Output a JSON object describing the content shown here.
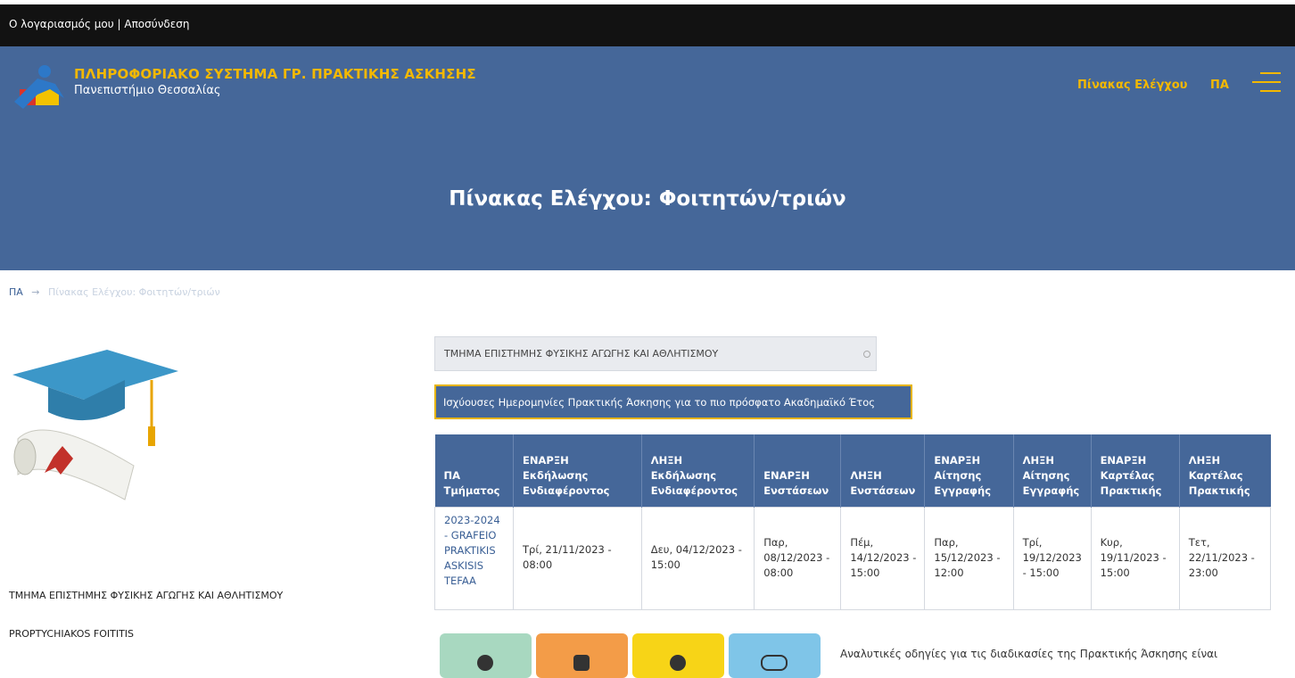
{
  "topbar": {
    "my_account": "Ο λογαριασμός μου",
    "separator": "|",
    "logout": "Αποσύνδεση"
  },
  "header": {
    "site_title": "ΠΛΗΡΟΦΟΡΙΑΚΟ ΣΥΣΤΗΜΑ ΓΡ. ΠΡΑΚΤΙΚΗΣ ΑΣΚΗΣΗΣ",
    "site_subtitle": "Πανεπιστήμιο Θεσσαλίας",
    "nav_dashboard": "Πίνακας Ελέγχου",
    "nav_pa": "ΠΑ",
    "page_title": "Πίνακας Ελέγχου: Φοιτητών/τριών"
  },
  "breadcrumb": {
    "home": "ΠΑ",
    "arrow": "→",
    "current": "Πίνακας Ελέγχου: Φοιτητών/τριών"
  },
  "sidebar": {
    "department": "ΤΜΗΜΑ ΕΠΙΣΤΗΜΗΣ ΦΥΣΙΚΗΣ ΑΓΩΓΗΣ ΚΑΙ ΑΘΛΗΤΙΣΜΟΥ",
    "student_type": "PROPTYCHIAKOS FOITITIS"
  },
  "main": {
    "department_select": "ΤΜΗΜΑ ΕΠΙΣΤΗΜΗΣ ΦΥΣΙΚΗΣ ΑΓΩΓΗΣ ΚΑΙ ΑΘΛΗΤΙΣΜΟΥ",
    "notice": "Ισχύουσες Ημερομηνίες Πρακτικής Άσκησης για το πιο πρόσφατο Ακαδημαϊκό Έτος",
    "table": {
      "headers": [
        "ΠΑ Τμήματος",
        "ΕΝΑΡΞΗ Εκδήλωσης Ενδιαφέροντος",
        "ΛΗΞΗ Εκδήλωσης Ενδιαφέροντος",
        "ΕΝΑΡΞΗ Ενστάσεων",
        "ΛΗΞΗ Ενστάσεων",
        "ΕΝΑΡΞΗ Αίτησης Εγγραφής",
        "ΛΗΞΗ Αίτησης Εγγραφής",
        "ΕΝΑΡΞΗ Καρτέλας Πρακτικής",
        "ΛΗΞΗ Καρτέλας Πρακτικής"
      ],
      "row": [
        "2023-2024 - GRAFEIO PRAKTIKIS ASKISIS TEFAA",
        "Τρί, 21/11/2023 - 08:00",
        "Δευ, 04/12/2023 - 15:00",
        "Παρ, 08/12/2023 - 08:00",
        "Πέμ, 14/12/2023 - 15:00",
        "Παρ, 15/12/2023 - 12:00",
        "Τρί, 19/12/2023 - 15:00",
        "Κυρ, 19/11/2023 - 15:00",
        "Τετ, 22/11/2023 - 23:00"
      ]
    },
    "guide_text": "Αναλυτικές οδηγίες για τις διαδικασίες της Πρακτικής Άσκησης είναι",
    "tiles": [
      {
        "icon": "user-icon",
        "color": "#a8d8c0"
      },
      {
        "icon": "badge-icon",
        "color": "#f39c48"
      },
      {
        "icon": "star-icon",
        "color": "#f7d417"
      },
      {
        "icon": "handshake-icon",
        "color": "#7fc5e8"
      }
    ]
  },
  "colors": {
    "header_bg": "#456799",
    "topbar_bg": "#121212",
    "accent": "#f3b800"
  }
}
